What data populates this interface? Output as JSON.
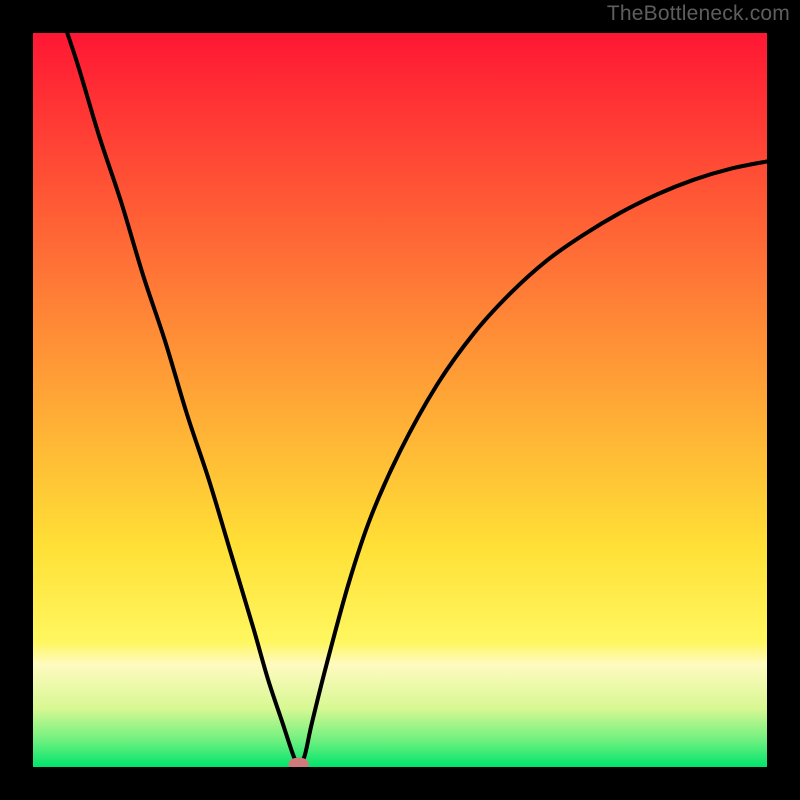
{
  "watermark": "TheBottleneck.com",
  "colors": {
    "frame": "#000000",
    "watermark": "#5e5e5e",
    "curve": "#000000",
    "marker_fill": "#cf7a7b",
    "gradient_top": "#ff1734",
    "gradient_mid1": "#ff7c36",
    "gradient_mid2": "#ffe036",
    "gradient_band": "#fffac0",
    "gradient_bottom": "#00e46b"
  },
  "chart_data": {
    "type": "line",
    "title": "",
    "xlabel": "",
    "ylabel": "",
    "xlim": [
      0,
      100
    ],
    "ylim": [
      0,
      100
    ],
    "gradient_stops": [
      {
        "offset": 0.0,
        "color": "#ff1734"
      },
      {
        "offset": 0.4,
        "color": "#ff8a36"
      },
      {
        "offset": 0.7,
        "color": "#ffe036"
      },
      {
        "offset": 0.83,
        "color": "#fff760"
      },
      {
        "offset": 0.86,
        "color": "#fffac0"
      },
      {
        "offset": 0.92,
        "color": "#d8f893"
      },
      {
        "offset": 0.965,
        "color": "#6bf07f"
      },
      {
        "offset": 1.0,
        "color": "#00e46b"
      }
    ],
    "series": [
      {
        "name": "bottleneck-curve",
        "x": [
          0,
          3,
          6,
          9,
          12,
          15,
          18,
          21,
          24,
          27,
          30,
          32,
          34,
          35.5,
          36.2,
          37,
          38,
          40,
          43,
          46,
          50,
          55,
          60,
          65,
          70,
          75,
          80,
          85,
          90,
          95,
          100
        ],
        "y": [
          115,
          105,
          96,
          86,
          77,
          67,
          58,
          48,
          39,
          29,
          19,
          12,
          6,
          1.5,
          0.4,
          1.5,
          6,
          14,
          25,
          34,
          43,
          52,
          59,
          64.5,
          69,
          72.5,
          75.5,
          78,
          80,
          81.5,
          82.5
        ]
      }
    ],
    "marker": {
      "x": 36.2,
      "y": 0.4,
      "rx": 1.4,
      "ry": 0.9
    }
  }
}
